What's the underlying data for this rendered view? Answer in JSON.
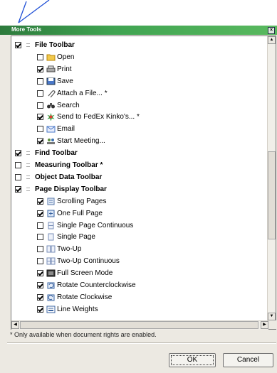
{
  "dialog": {
    "title": "More Tools"
  },
  "items": [
    {
      "label": "File Toolbar",
      "checked": true,
      "group": true
    },
    {
      "label": "Open",
      "checked": false,
      "icon": "folder-icon"
    },
    {
      "label": "Print",
      "checked": true,
      "icon": "printer-icon"
    },
    {
      "label": "Save",
      "checked": false,
      "icon": "save-icon"
    },
    {
      "label": "Attach a File... *",
      "checked": false,
      "icon": "paperclip-icon"
    },
    {
      "label": "Search",
      "checked": false,
      "icon": "binoculars-icon"
    },
    {
      "label": "Send to FedEx Kinko's... *",
      "checked": true,
      "icon": "fedex-kinkos-icon"
    },
    {
      "label": "Email",
      "checked": false,
      "icon": "email-icon"
    },
    {
      "label": "Start Meeting...",
      "checked": true,
      "icon": "meeting-icon"
    },
    {
      "label": "Find Toolbar",
      "checked": true,
      "group": true
    },
    {
      "label": "Measuring Toolbar *",
      "checked": false,
      "group": true
    },
    {
      "label": "Object Data Toolbar",
      "checked": false,
      "group": true
    },
    {
      "label": "Page Display Toolbar",
      "checked": true,
      "group": true
    },
    {
      "label": "Scrolling Pages",
      "checked": true,
      "icon": "scrolling-pages-icon"
    },
    {
      "label": "One Full Page",
      "checked": true,
      "icon": "one-full-page-icon"
    },
    {
      "label": "Single Page Continuous",
      "checked": false,
      "icon": "single-page-continuous-icon"
    },
    {
      "label": "Single Page",
      "checked": false,
      "icon": "single-page-icon"
    },
    {
      "label": "Two-Up",
      "checked": false,
      "icon": "two-up-icon"
    },
    {
      "label": "Two-Up Continuous",
      "checked": false,
      "icon": "two-up-continuous-icon"
    },
    {
      "label": "Full Screen Mode",
      "checked": true,
      "icon": "full-screen-icon"
    },
    {
      "label": "Rotate Counterclockwise",
      "checked": true,
      "icon": "rotate-ccw-icon"
    },
    {
      "label": "Rotate Clockwise",
      "checked": true,
      "icon": "rotate-cw-icon"
    },
    {
      "label": "Line Weights",
      "checked": true,
      "icon": "line-weights-icon"
    }
  ],
  "footnote": "* Only available when document rights are enabled.",
  "buttons": {
    "ok": "OK",
    "cancel": "Cancel"
  },
  "colors": {
    "titlebar": "#3fa351",
    "pointer": "#1f4fd6"
  }
}
